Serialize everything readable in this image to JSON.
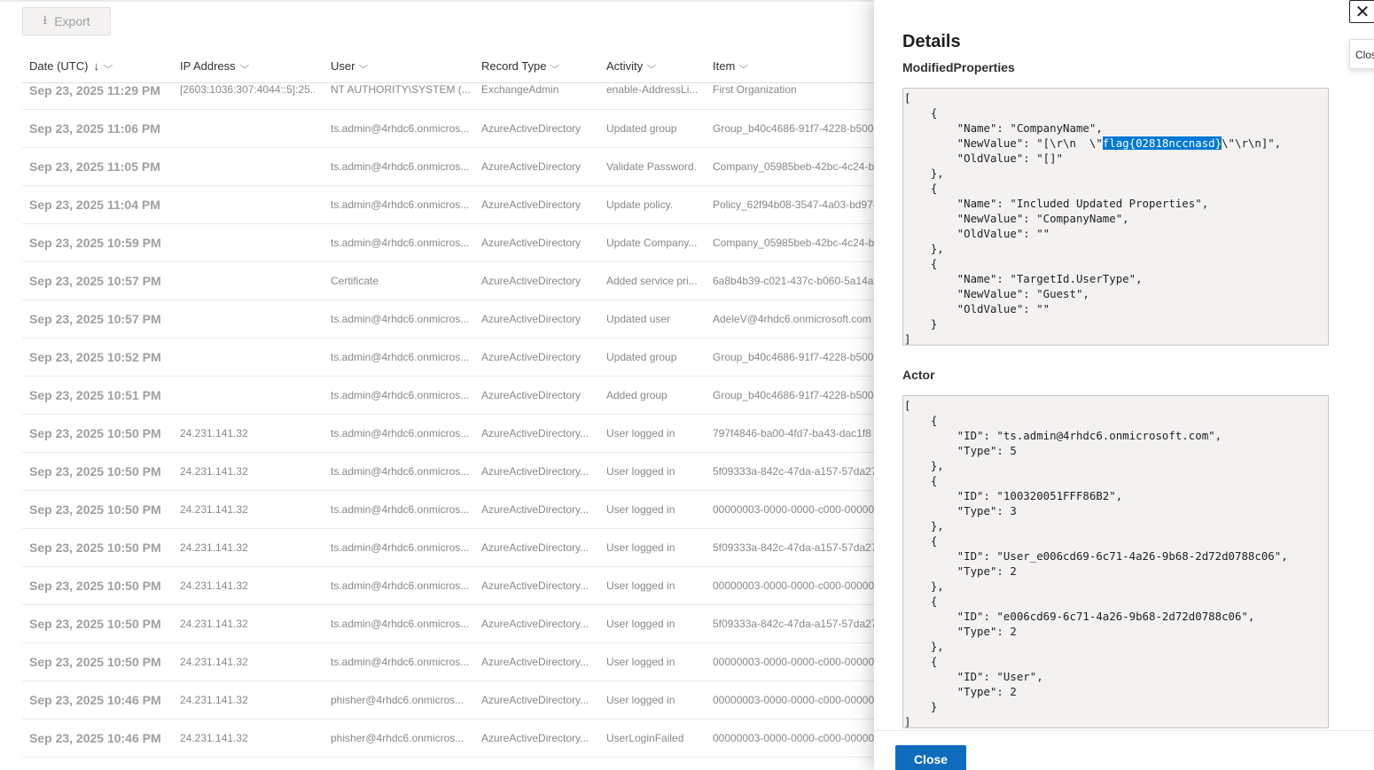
{
  "toolbar": {
    "export_label": "Export",
    "export_icon": "download-icon"
  },
  "table": {
    "headers": [
      {
        "label": "Date (UTC)",
        "sorted": "descending"
      },
      {
        "label": "IP Address"
      },
      {
        "label": "User"
      },
      {
        "label": "Record Type"
      },
      {
        "label": "Activity"
      },
      {
        "label": "Item"
      }
    ],
    "rows": [
      {
        "date": "Sep 23, 2025 11:29 PM",
        "ip": "[2603:1036:307:4044::5]:25...",
        "user": "NT AUTHORITY\\SYSTEM (...",
        "record_type": "ExchangeAdmin",
        "activity": "enable-AddressLi...",
        "item": "First Organization"
      },
      {
        "date": "Sep 23, 2025 11:06 PM",
        "ip": "",
        "user": "ts.admin@4rhdc6.onmicros...",
        "record_type": "AzureActiveDirectory",
        "activity": "Updated group",
        "item": "Group_b40c4686-91f7-4228-b500-"
      },
      {
        "date": "Sep 23, 2025 11:05 PM",
        "ip": "",
        "user": "ts.admin@4rhdc6.onmicros...",
        "record_type": "AzureActiveDirectory",
        "activity": "Validate Password.",
        "item": "Company_05985beb-42bc-4c24-b"
      },
      {
        "date": "Sep 23, 2025 11:04 PM",
        "ip": "",
        "user": "ts.admin@4rhdc6.onmicros...",
        "record_type": "AzureActiveDirectory",
        "activity": "Update policy.",
        "item": "Policy_62f94b08-3547-4a03-bd97-"
      },
      {
        "date": "Sep 23, 2025 10:59 PM",
        "ip": "",
        "user": "ts.admin@4rhdc6.onmicros...",
        "record_type": "AzureActiveDirectory",
        "activity": "Update Company...",
        "item": "Company_05985beb-42bc-4c24-b"
      },
      {
        "date": "Sep 23, 2025 10:57 PM",
        "ip": "",
        "user": "Certificate",
        "record_type": "AzureActiveDirectory",
        "activity": "Added service pri...",
        "item": "6a8b4b39-c021-437c-b060-5a14a"
      },
      {
        "date": "Sep 23, 2025 10:57 PM",
        "ip": "",
        "user": "ts.admin@4rhdc6.onmicros...",
        "record_type": "AzureActiveDirectory",
        "activity": "Updated user",
        "item": "AdeleV@4rhdc6.onmicrosoft.com"
      },
      {
        "date": "Sep 23, 2025 10:52 PM",
        "ip": "",
        "user": "ts.admin@4rhdc6.onmicros...",
        "record_type": "AzureActiveDirectory",
        "activity": "Updated group",
        "item": "Group_b40c4686-91f7-4228-b500-"
      },
      {
        "date": "Sep 23, 2025 10:51 PM",
        "ip": "",
        "user": "ts.admin@4rhdc6.onmicros...",
        "record_type": "AzureActiveDirectory",
        "activity": "Added group",
        "item": "Group_b40c4686-91f7-4228-b500-"
      },
      {
        "date": "Sep 23, 2025 10:50 PM",
        "ip": "24.231.141.32",
        "user": "ts.admin@4rhdc6.onmicros...",
        "record_type": "AzureActiveDirectory...",
        "activity": "User logged in",
        "item": "797f4846-ba00-4fd7-ba43-dac1f8"
      },
      {
        "date": "Sep 23, 2025 10:50 PM",
        "ip": "24.231.141.32",
        "user": "ts.admin@4rhdc6.onmicros...",
        "record_type": "AzureActiveDirectory...",
        "activity": "User logged in",
        "item": "5f09333a-842c-47da-a157-57da27"
      },
      {
        "date": "Sep 23, 2025 10:50 PM",
        "ip": "24.231.141.32",
        "user": "ts.admin@4rhdc6.onmicros...",
        "record_type": "AzureActiveDirectory...",
        "activity": "User logged in",
        "item": "00000003-0000-0000-c000-000000"
      },
      {
        "date": "Sep 23, 2025 10:50 PM",
        "ip": "24.231.141.32",
        "user": "ts.admin@4rhdc6.onmicros...",
        "record_type": "AzureActiveDirectory...",
        "activity": "User logged in",
        "item": "5f09333a-842c-47da-a157-57da27"
      },
      {
        "date": "Sep 23, 2025 10:50 PM",
        "ip": "24.231.141.32",
        "user": "ts.admin@4rhdc6.onmicros...",
        "record_type": "AzureActiveDirectory...",
        "activity": "User logged in",
        "item": "00000003-0000-0000-c000-000000"
      },
      {
        "date": "Sep 23, 2025 10:50 PM",
        "ip": "24.231.141.32",
        "user": "ts.admin@4rhdc6.onmicros...",
        "record_type": "AzureActiveDirectory...",
        "activity": "User logged in",
        "item": "5f09333a-842c-47da-a157-57da27"
      },
      {
        "date": "Sep 23, 2025 10:50 PM",
        "ip": "24.231.141.32",
        "user": "ts.admin@4rhdc6.onmicros...",
        "record_type": "AzureActiveDirectory...",
        "activity": "User logged in",
        "item": "00000003-0000-0000-c000-000000"
      },
      {
        "date": "Sep 23, 2025 10:46 PM",
        "ip": "24.231.141.32",
        "user": "phisher@4rhdc6.onmicros...",
        "record_type": "AzureActiveDirectory...",
        "activity": "User logged in",
        "item": "00000003-0000-0000-c000-000000"
      },
      {
        "date": "Sep 23, 2025 10:46 PM",
        "ip": "24.231.141.32",
        "user": "phisher@4rhdc6.onmicros...",
        "record_type": "AzureActiveDirectory...",
        "activity": "UserLoginFailed",
        "item": "00000003-0000-0000-c000-000000"
      }
    ]
  },
  "panel": {
    "title": "Details",
    "close_tooltip": "Close",
    "close_icon": "close-icon",
    "close_button_label": "Close",
    "sections": [
      {
        "label": "ModifiedProperties",
        "lines": [
          "[",
          "    {",
          "        \"Name\": \"CompanyName\",",
          "        \"NewValue\": \"[\\r\\n  \\\"flag{02818nccnasd}\\\"\\r\\n]\",",
          "        \"OldValue\": \"[]\"",
          "    },",
          "    {",
          "        \"Name\": \"Included Updated Properties\",",
          "        \"NewValue\": \"CompanyName\",",
          "        \"OldValue\": \"\"",
          "    },",
          "    {",
          "        \"Name\": \"TargetId.UserType\",",
          "        \"NewValue\": \"Guest\",",
          "        \"OldValue\": \"\"",
          "    }",
          "]"
        ],
        "selected_text": "flag{02818nccnasd}"
      },
      {
        "label": "Actor",
        "lines": [
          "[",
          "    {",
          "        \"ID\": \"ts.admin@4rhdc6.onmicrosoft.com\",",
          "        \"Type\": 5",
          "    },",
          "    {",
          "        \"ID\": \"100320051FFF86B2\",",
          "        \"Type\": 3",
          "    },",
          "    {",
          "        \"ID\": \"User_e006cd69-6c71-4a26-9b68-2d72d0788c06\",",
          "        \"Type\": 2",
          "    },",
          "    {",
          "        \"ID\": \"e006cd69-6c71-4a26-9b68-2d72d0788c06\",",
          "        \"Type\": 2",
          "    },",
          "    {",
          "        \"ID\": \"User\",",
          "        \"Type\": 2",
          "    }",
          "]"
        ]
      }
    ]
  },
  "colors": {
    "accent": "#0f6cbd",
    "selection": "#0078d4"
  }
}
